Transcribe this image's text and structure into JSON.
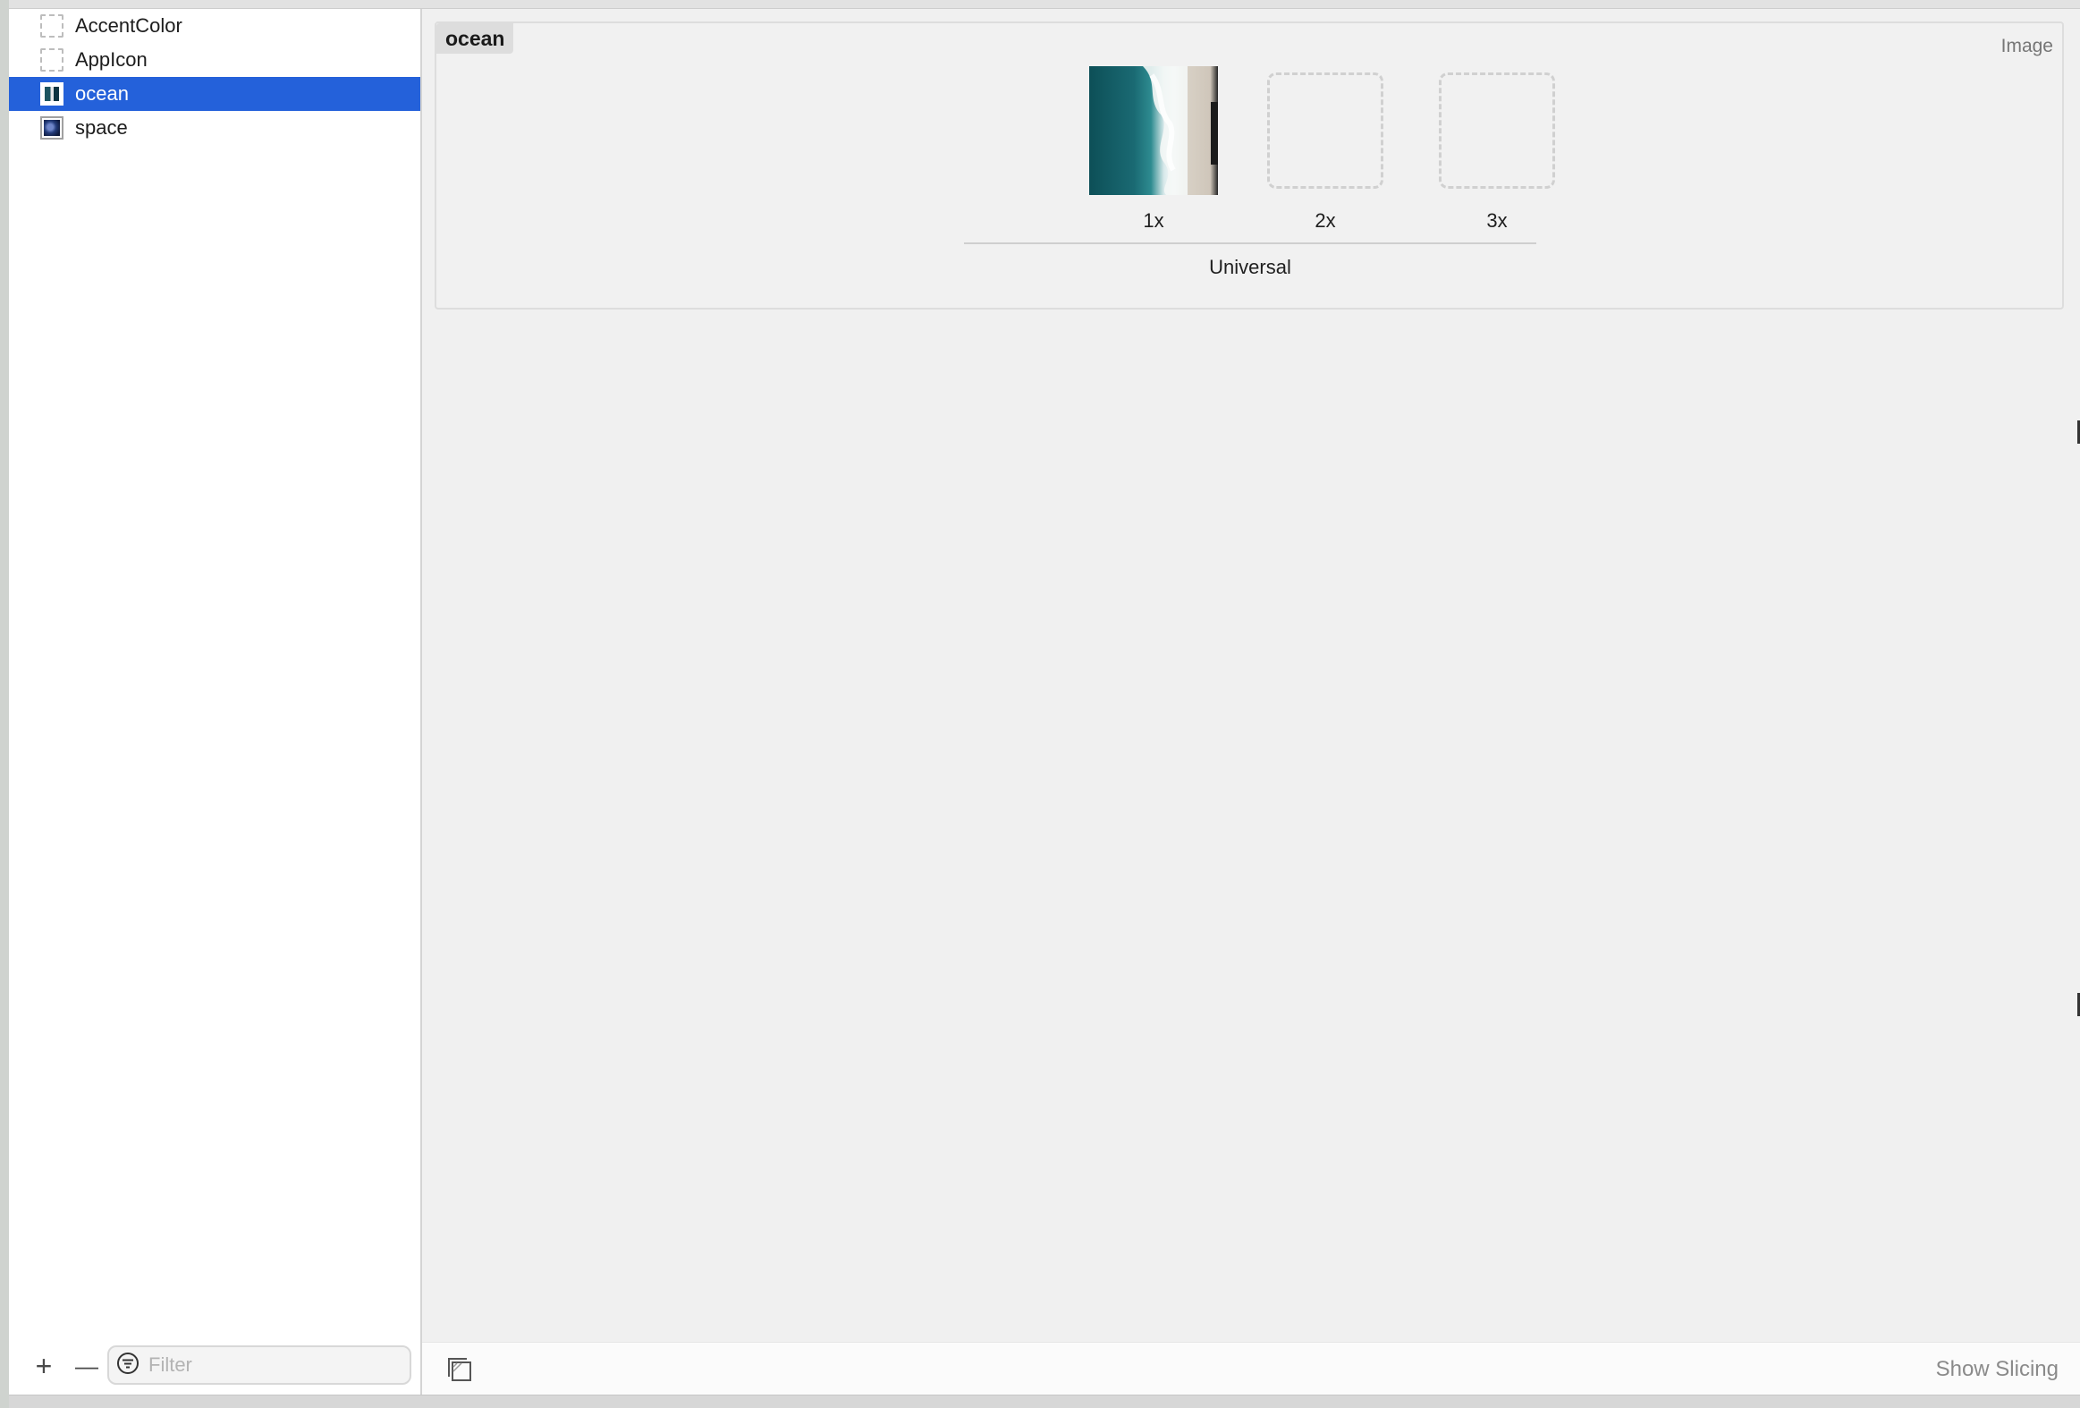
{
  "sidebar": {
    "items": [
      {
        "label": "AccentColor",
        "icon": "color-set-icon",
        "selected": false
      },
      {
        "label": "AppIcon",
        "icon": "app-icon-set-icon",
        "selected": false
      },
      {
        "label": "ocean",
        "icon": "image-thumbnail-icon",
        "selected": true
      },
      {
        "label": "space",
        "icon": "image-thumbnail-icon",
        "selected": false
      }
    ],
    "footer": {
      "add_label": "+",
      "remove_label": "—",
      "filter_placeholder": "Filter",
      "filter_value": ""
    }
  },
  "editor": {
    "asset_name": "ocean",
    "asset_type": "Image",
    "slots": [
      {
        "label": "1x",
        "filled": true
      },
      {
        "label": "2x",
        "filled": false
      },
      {
        "label": "3x",
        "filled": false
      }
    ],
    "group_label": "Universal"
  },
  "bottom_bar": {
    "show_slicing_label": "Show Slicing"
  },
  "colors": {
    "selection": "#2461da",
    "editor_background": "#f0f0f0",
    "sidebar_background": "#ffffff"
  }
}
